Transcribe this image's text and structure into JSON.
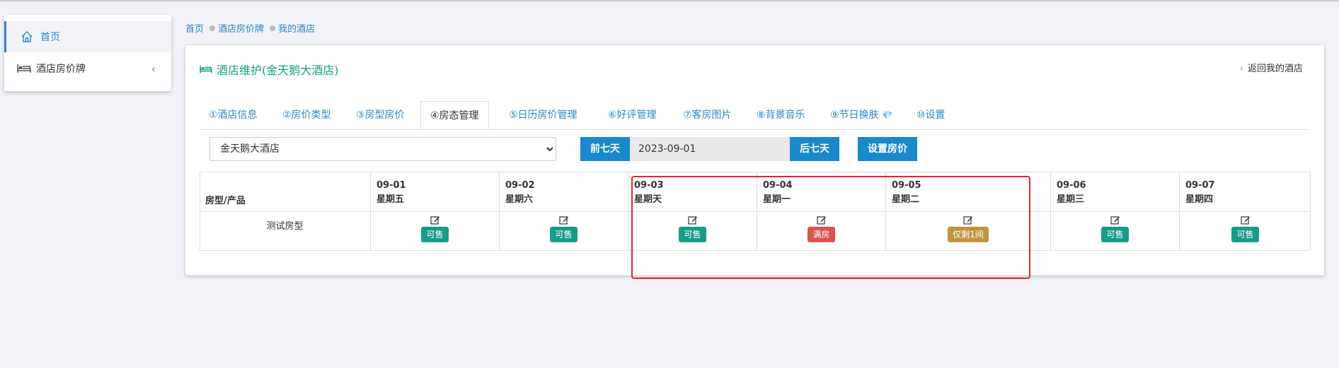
{
  "sidebar": {
    "items": [
      {
        "label": "首页",
        "icon": "home-icon"
      },
      {
        "label": "酒店房价牌",
        "icon": "bed-icon",
        "chevron": "‹"
      }
    ]
  },
  "breadcrumb": [
    "首页",
    "酒店房价牌",
    "我的酒店"
  ],
  "panel": {
    "title": "酒店维护(金天鹅大酒店)",
    "back_link": "返回我的酒店",
    "back_chevron": "‹"
  },
  "tabs": [
    {
      "label": "①酒店信息"
    },
    {
      "label": "②房价类型"
    },
    {
      "label": "③房型房价"
    },
    {
      "label": "④房态管理",
      "active": true
    },
    {
      "label": "⑤日历房价管理"
    },
    {
      "label": "⑥好评管理"
    },
    {
      "label": "⑦客房图片"
    },
    {
      "label": "⑧背景音乐"
    },
    {
      "label": "⑨节日换肤"
    },
    {
      "label": "⑩设置"
    }
  ],
  "controls": {
    "hotel_select": "金天鹅大酒店",
    "prev_week": "前七天",
    "date": "2023-09-01",
    "next_week": "后七天",
    "set_price": "设置房价"
  },
  "table": {
    "first_header": "房型/产品",
    "room_type": "测试房型",
    "days": [
      {
        "date": "09-01",
        "weekday": "星期五",
        "status": "可售",
        "color": "#169c8a"
      },
      {
        "date": "09-02",
        "weekday": "星期六",
        "status": "可售",
        "color": "#169c8a"
      },
      {
        "date": "09-03",
        "weekday": "星期天",
        "status": "可售",
        "color": "#169c8a"
      },
      {
        "date": "09-04",
        "weekday": "星期一",
        "status": "满房",
        "color": "#d9534f"
      },
      {
        "date": "09-05",
        "weekday": "星期二",
        "status": "仅剩1间",
        "color": "#c1953f"
      },
      {
        "date": "09-06",
        "weekday": "星期三",
        "status": "可售",
        "color": "#169c8a"
      },
      {
        "date": "09-07",
        "weekday": "星期四",
        "status": "可售",
        "color": "#169c8a"
      }
    ]
  },
  "colors": {
    "accent": "#2f86c6",
    "title_green": "#16a085",
    "button_blue": "#1a88cc",
    "highlight_red": "#e3262b"
  }
}
